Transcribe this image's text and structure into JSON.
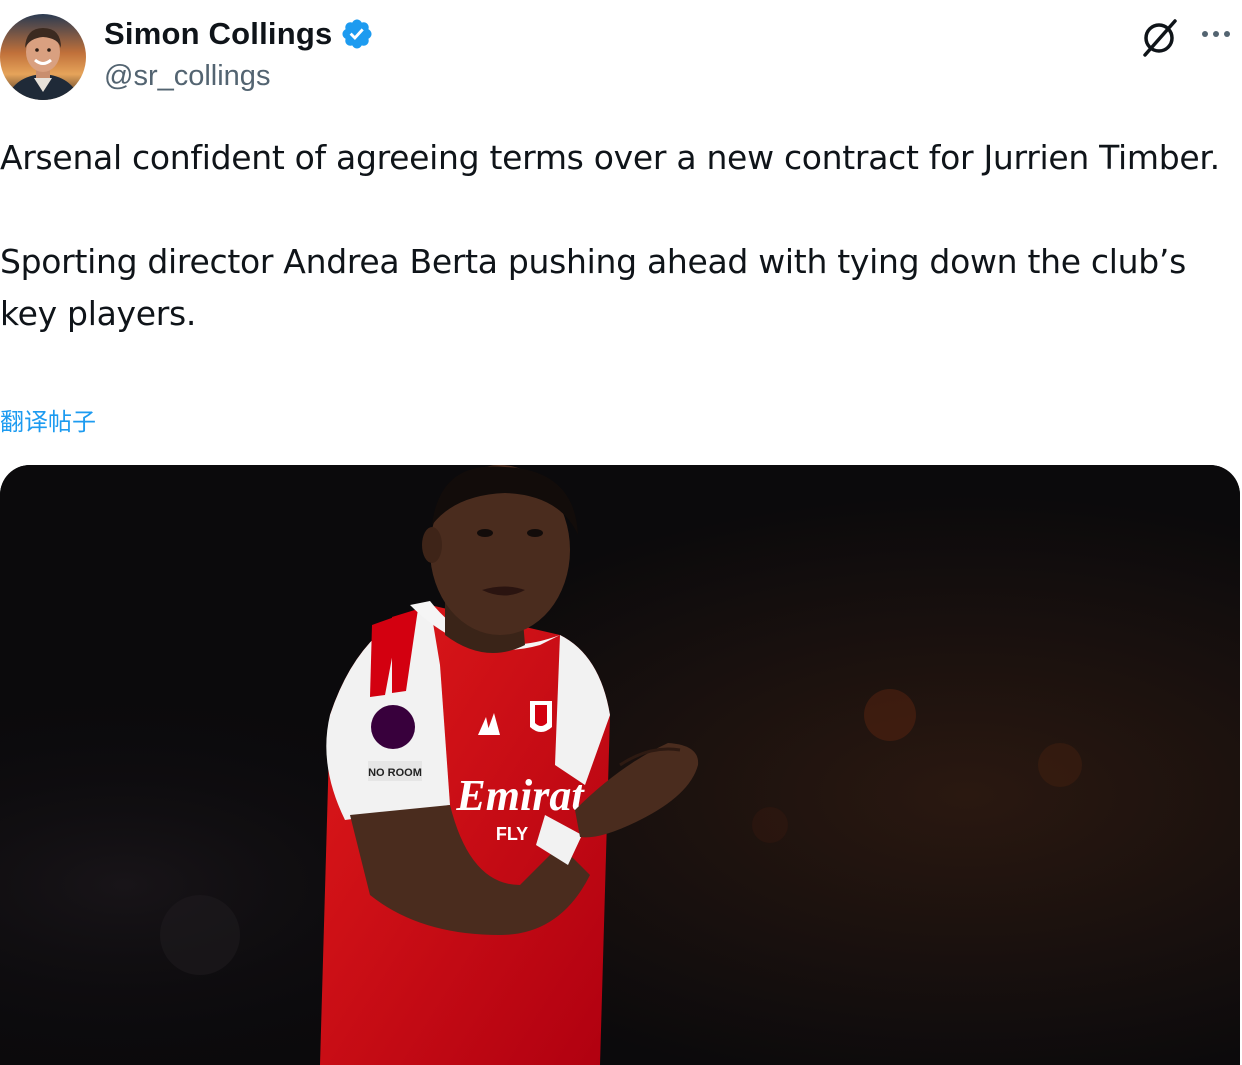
{
  "author": {
    "display_name": "Simon Collings",
    "handle": "@sr_collings",
    "verified": true,
    "verified_badge_color": "#1d9bf0"
  },
  "actions": {
    "grok_icon": "slashed-circle-icon",
    "more_icon": "ellipsis-icon"
  },
  "tweet": {
    "paragraph_1": "Arsenal confident of agreeing terms over a new contract for Jurrien Timber.",
    "paragraph_2": "Sporting director Andrea Berta pushing ahead with tying down the club’s key players.",
    "translate_label": "翻译帖子"
  },
  "media": {
    "shirt_sponsor": "Emirat",
    "shirt_sponsor_line2": "FLY",
    "sleeve_patch": "NO ROOM"
  },
  "colors": {
    "link_blue": "#1d9bf0",
    "secondary_text": "#536471",
    "arsenal_red": "#db0007"
  }
}
